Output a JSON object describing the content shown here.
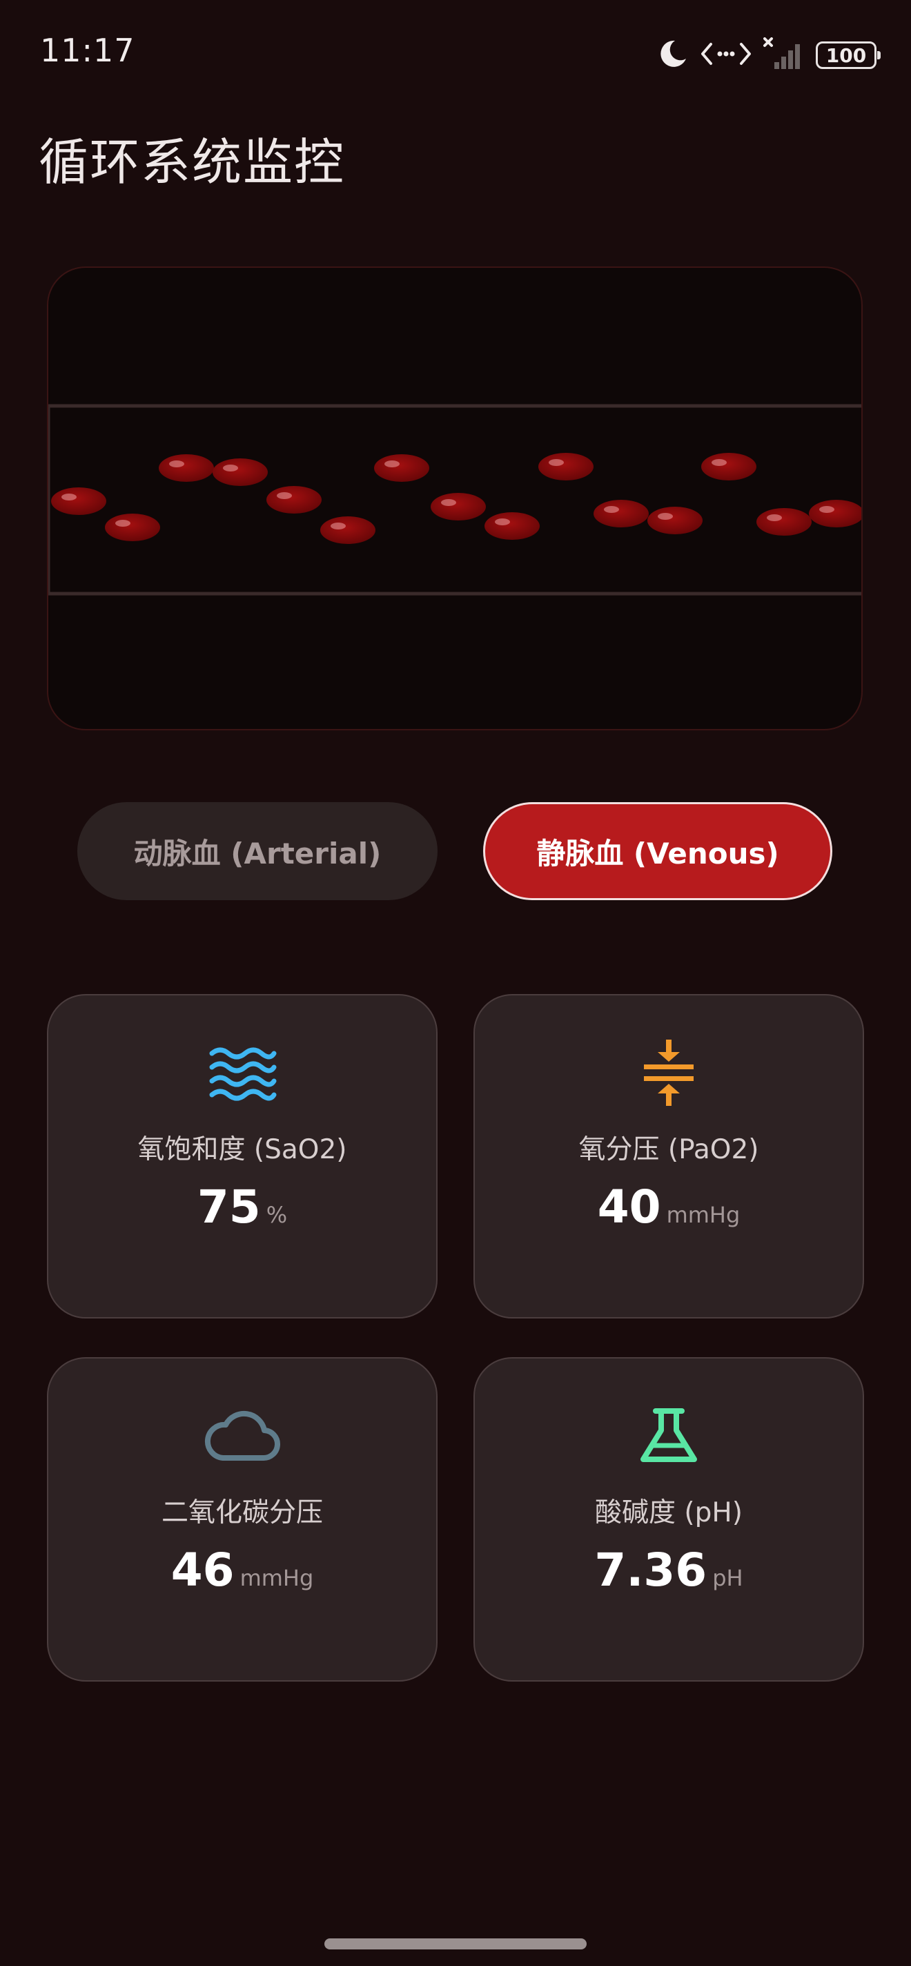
{
  "status_bar": {
    "time": "11:17",
    "battery": "100",
    "icons": [
      "moon-icon",
      "data-transfer-icon",
      "signal-icon",
      "battery-icon"
    ]
  },
  "page": {
    "title": "循环系统监控"
  },
  "toggle": {
    "arterial_label": "动脉血 (Arterial)",
    "venous_label": "静脉血 (Venous)",
    "selected": "venous"
  },
  "metrics": [
    {
      "icon": "waves-icon",
      "label": "氧饱和度 (SaO2)",
      "value": "75",
      "unit": "%",
      "color": "#3fb6f2"
    },
    {
      "icon": "compress-arrows-icon",
      "label": "氧分压 (PaO2)",
      "value": "40",
      "unit": "mmHg",
      "color": "#f39a2b"
    },
    {
      "icon": "cloud-icon",
      "label": "二氧化碳分压",
      "value": "46",
      "unit": "mmHg",
      "color": "#5f7c8b"
    },
    {
      "icon": "flask-icon",
      "label": "酸碱度 (pH)",
      "value": "7.36",
      "unit": "pH",
      "color": "#59e6a4"
    }
  ],
  "colors": {
    "background": "#190b0c",
    "accent": "#b71b1d",
    "card": "#2d2223",
    "blood_cell": "#8e0a0a"
  }
}
